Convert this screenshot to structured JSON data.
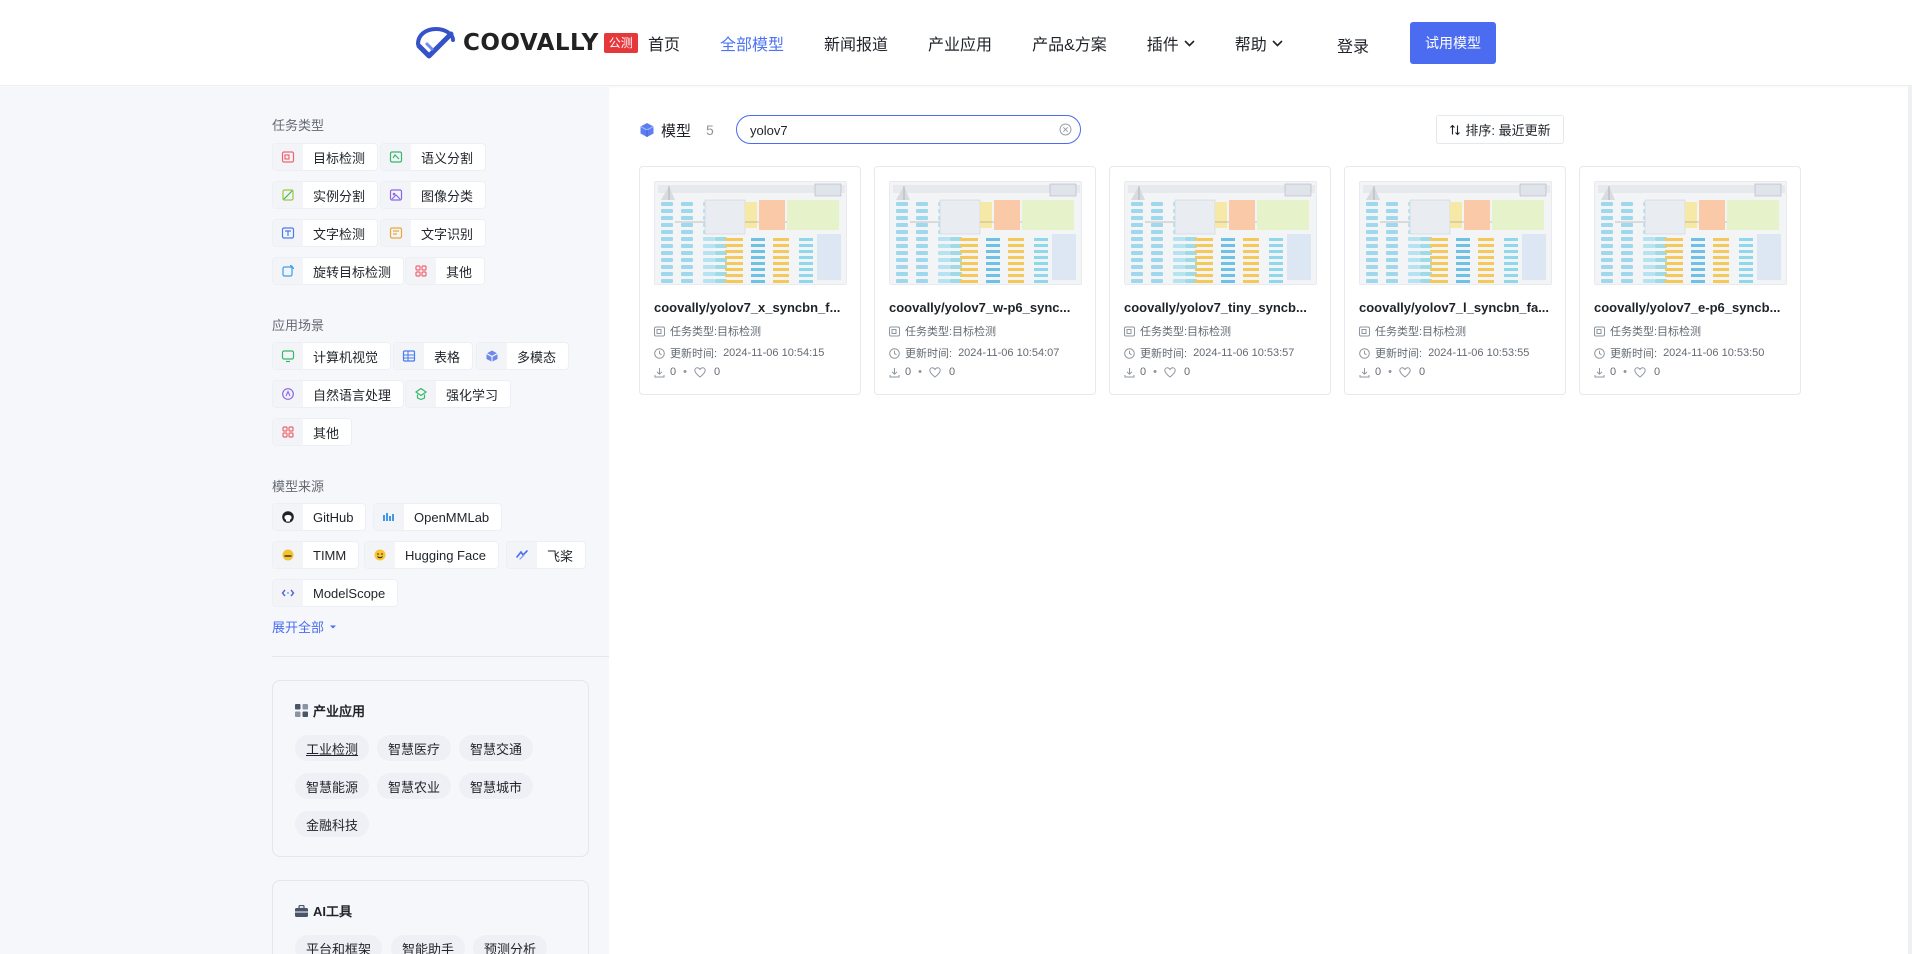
{
  "header": {
    "logo_text": "COOVALLY",
    "beta_badge": "公测",
    "nav": [
      {
        "label": "首页",
        "active": false
      },
      {
        "label": "全部模型",
        "active": true
      },
      {
        "label": "新闻报道",
        "active": false
      },
      {
        "label": "产业应用",
        "active": false
      },
      {
        "label": "产品&方案",
        "active": false
      },
      {
        "label": "插件",
        "active": false,
        "dropdown": true
      },
      {
        "label": "帮助",
        "active": false,
        "dropdown": true
      }
    ],
    "login": "登录",
    "try_button": "试用模型"
  },
  "sidebar": {
    "task_types": {
      "title": "任务类型",
      "items": [
        "目标检测",
        "语义分割",
        "实例分割",
        "图像分类",
        "文字检测",
        "文字识别",
        "旋转目标检测",
        "其他"
      ]
    },
    "scenarios": {
      "title": "应用场景",
      "items": [
        "计算机视觉",
        "表格",
        "多模态",
        "自然语言处理",
        "强化学习",
        "其他"
      ]
    },
    "sources": {
      "title": "模型来源",
      "items": [
        "GitHub",
        "OpenMMLab",
        "TIMM",
        "Hugging Face",
        "飞桨",
        "ModelScope"
      ]
    },
    "expand_all": "展开全部",
    "industry": {
      "title": "产业应用",
      "items": [
        "工业检测",
        "智慧医疗",
        "智慧交通",
        "智慧能源",
        "智慧农业",
        "智慧城市",
        "金融科技"
      ]
    },
    "ai_tools": {
      "title": "AI工具",
      "items": [
        "平台和框架",
        "智能助手",
        "预测分析"
      ]
    }
  },
  "main": {
    "title": "模型",
    "count": "5",
    "search_value": "yolov7",
    "sort_label": "排序: 最近更新",
    "cards": [
      {
        "title": "coovally/yolov7_x_syncbn_f...",
        "task": "任务类型:目标检测",
        "updated_label": "更新时间:",
        "updated": "2024-11-06 10:54:15",
        "downloads": "0",
        "likes": "0"
      },
      {
        "title": "coovally/yolov7_w-p6_sync...",
        "task": "任务类型:目标检测",
        "updated_label": "更新时间:",
        "updated": "2024-11-06 10:54:07",
        "downloads": "0",
        "likes": "0"
      },
      {
        "title": "coovally/yolov7_tiny_syncb...",
        "task": "任务类型:目标检测",
        "updated_label": "更新时间:",
        "updated": "2024-11-06 10:53:57",
        "downloads": "0",
        "likes": "0"
      },
      {
        "title": "coovally/yolov7_l_syncbn_fa...",
        "task": "任务类型:目标检测",
        "updated_label": "更新时间:",
        "updated": "2024-11-06 10:53:55",
        "downloads": "0",
        "likes": "0"
      },
      {
        "title": "coovally/yolov7_e-p6_syncb...",
        "task": "任务类型:目标检测",
        "updated_label": "更新时间:",
        "updated": "2024-11-06 10:53:50",
        "downloads": "0",
        "likes": "0"
      }
    ]
  },
  "colors": {
    "accent": "#4b6cf0",
    "beta": "#e6373b",
    "panel_bg": "#f6f7fb"
  }
}
